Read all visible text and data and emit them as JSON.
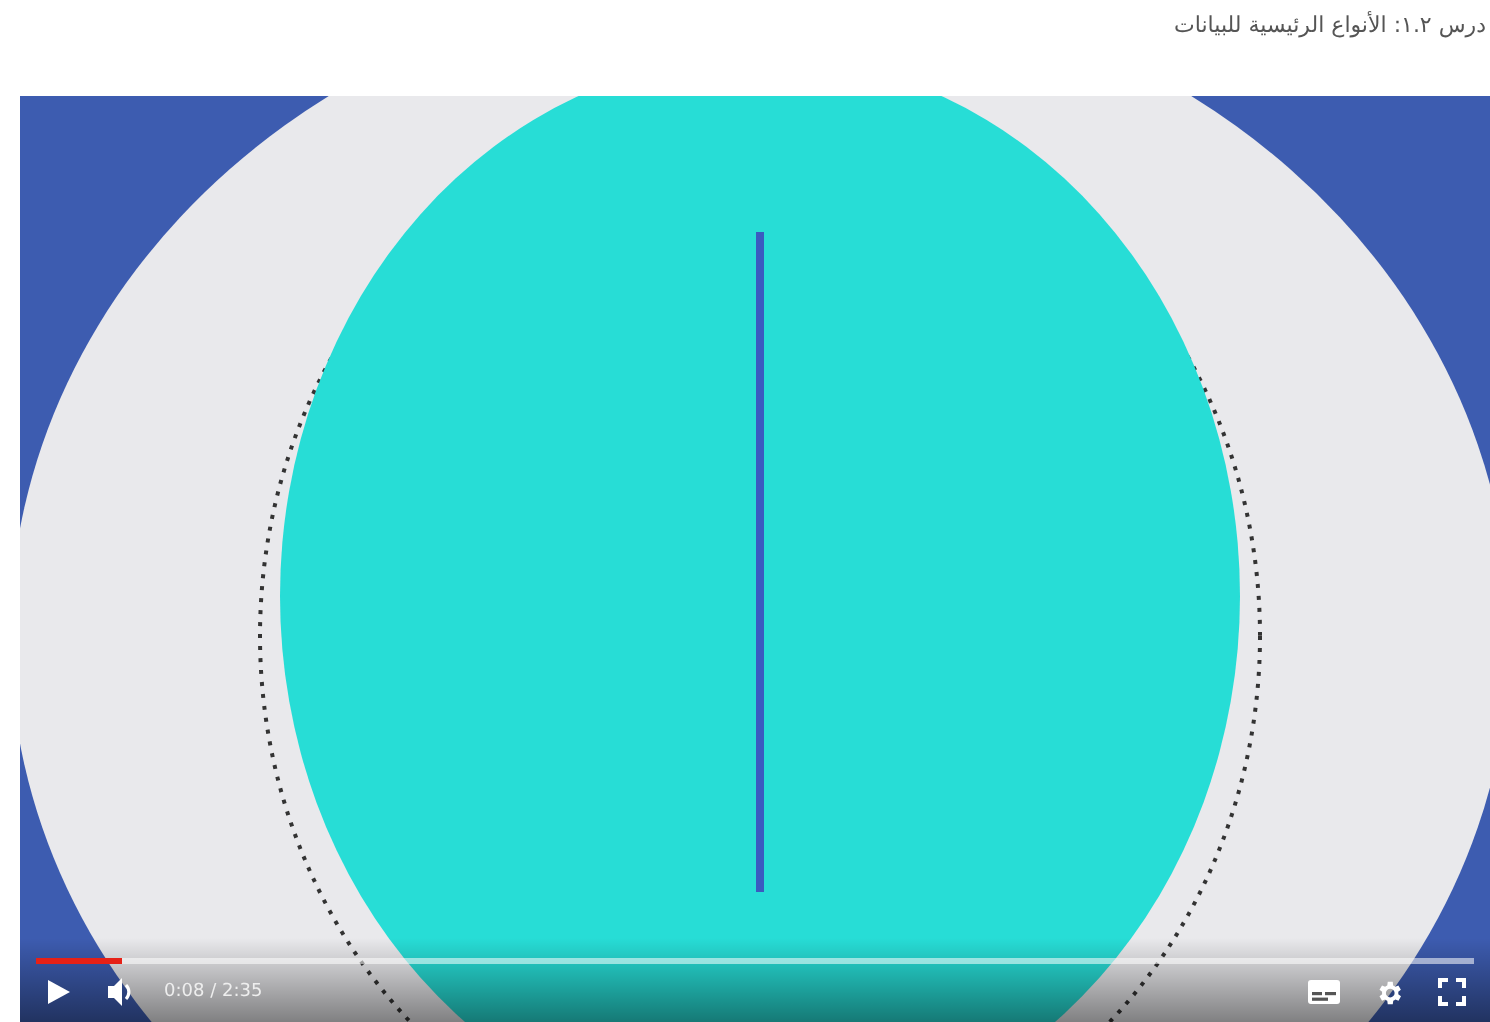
{
  "page_title": "درس ١.٢: الأنواع الرئيسية للبيانات",
  "player": {
    "playing": false,
    "muted": false,
    "progress": {
      "level": 0.06
    },
    "time": "0:08 / 2:35"
  }
}
